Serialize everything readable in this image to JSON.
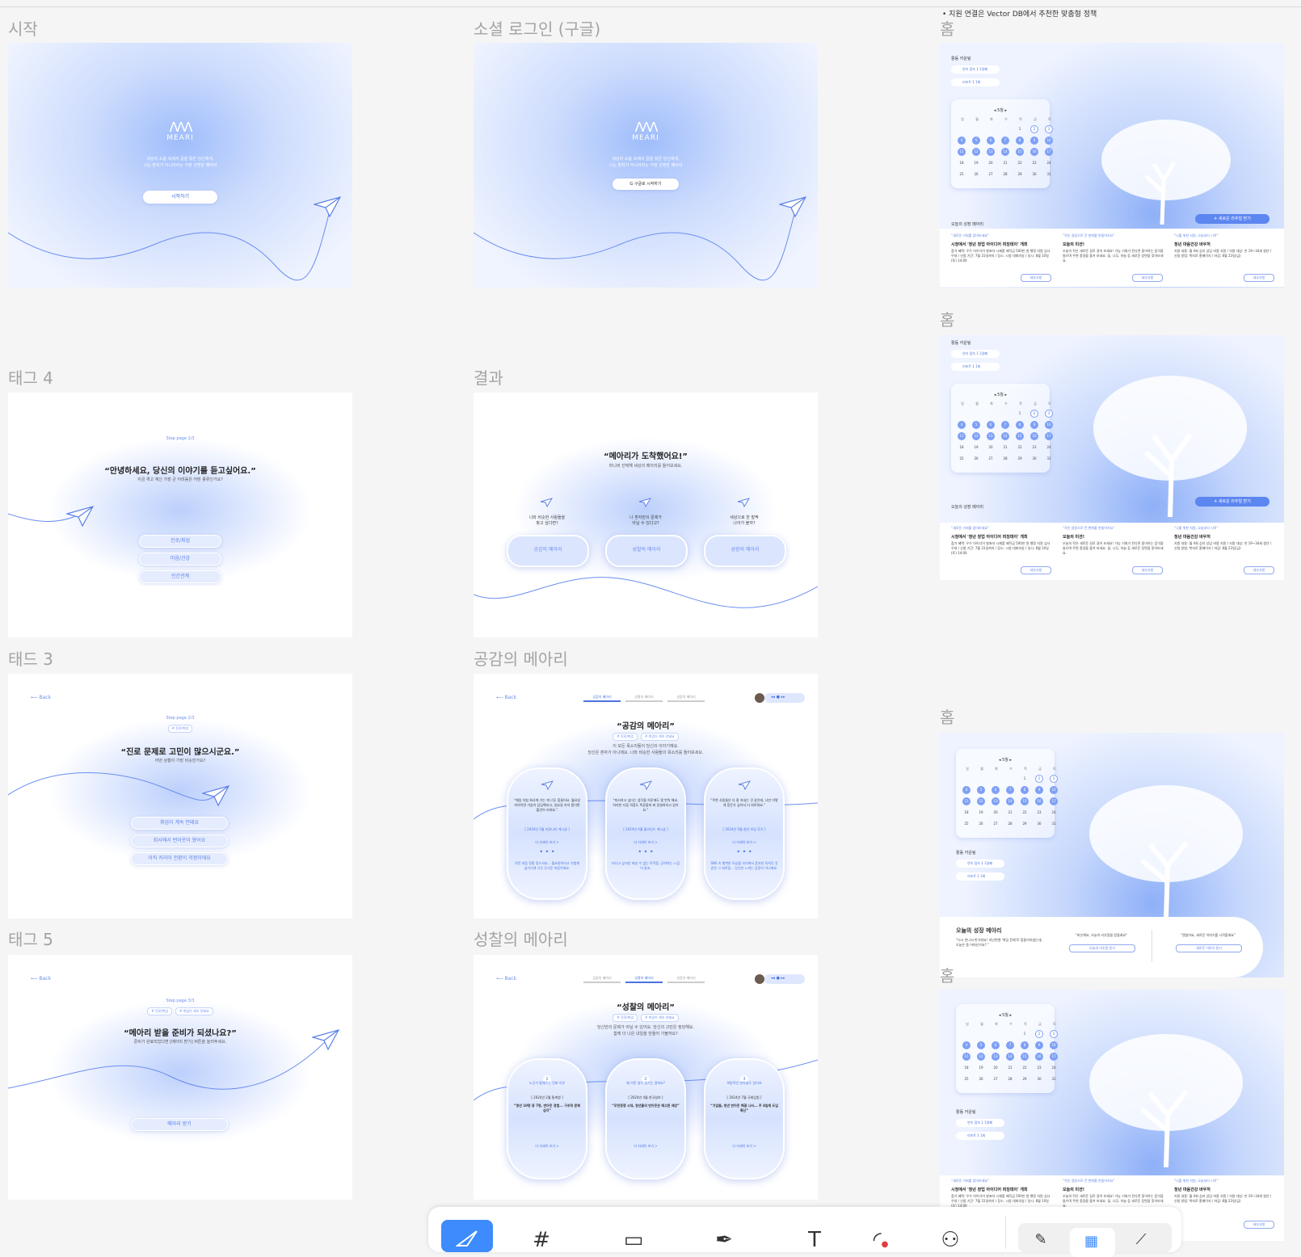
{
  "note": "• 지원 연결은 Vector DB에서 추천한 맞춤형 정책",
  "frames": {
    "start": {
      "label": "시작",
      "logo": "MEARI",
      "tagline1": "세상의 소음 속에서 길을 잃은 당신에게,",
      "tagline2": "나는 혼자가 아니라라는 가장 선명한 메아리",
      "button": "시작하기"
    },
    "social": {
      "label": "소셜 로그인 (구글)",
      "logo": "MEARI",
      "tagline1": "세상의 소음 속에서 길을 잃은 당신에게,",
      "tagline2": "나는 혼자가 아니라라는 가장 선명한 메아리",
      "button": "G  구글로 시작하기"
    },
    "tag4": {
      "label": "태그 4",
      "step": "Step page 1/3",
      "title": "“안녕하세요, 당신의 이야기를 듣고싶어요.”",
      "subtitle": "지금 겪고 계신 가장 큰 어려움은 어떤 종류인가요?",
      "options": [
        "진로/취업",
        "마음/건강",
        "인간관계"
      ]
    },
    "result": {
      "label": "결과",
      "title": "“메아리가 도착했어요!”",
      "subtitle": "마니버 선택해 세상의 메아리를 들어보세요.",
      "cols": [
        {
          "caption1": "나와 비슷한 사람들을",
          "caption2": "찾고 싶다면?",
          "button": "공감의 메아리"
        },
        {
          "caption1": "나 혼자만의 문제가",
          "caption2": "아닐 수 있다고?",
          "button": "성찰의 메아리"
        },
        {
          "caption1": "세상으로 한 발짝",
          "caption2": "나아가 볼까?",
          "button": "성장의 메아리"
        }
      ]
    },
    "tad3": {
      "label": "태드 3",
      "back": "Back",
      "step": "Step page 2/3",
      "chip": "# 진로/취업",
      "title": "“진로 문제로 고민이 많으시군요.”",
      "subtitle": "어떤 상황이 가장 비슷한가요?",
      "options": [
        "취업이 계속 안돼요",
        "회사에서 번아웃이 왔어요",
        "이직 커리어 전환이 걱정이에요"
      ]
    },
    "empathy": {
      "label": "공감의 메아리",
      "back": "Back",
      "tabs": [
        "공감의 메아리",
        "성찰의 메아리",
        "성장의 메아리"
      ],
      "title": "“공감의 메아리”",
      "chips": [
        "# 진로/취업",
        "# 취업이 계속 안돼요"
      ],
      "desc1": "이 모든 목소리들이 당신의 이야기예요.",
      "desc2": "당신은 혼자가 아니에요. 나와 비슷한 사람들의 목소리를 들어보세요.",
      "cards": [
        {
          "quote": "“매일 아침 회사에 가는 게 너무 힘들어요. 월요일 저녁이면 가슴이 답답해지고, 일요일 저녁 쯤이면 불안이 커져요.”",
          "src": "[ 2024년 3월 커뮤니티 게시글 ]",
          "more": "더 자세히 보기 >",
          "footer": "이런 마음 정말 힘드셔죠... 월요병이라고 가볍게 넘기기엔 너무 무거운 마음이에요."
        },
        {
          "quote": "“퇴사하고 싶다는 생각을 하루에도 몇 번씩 해요. 하지만 다음 직장도 똑같을까 봐 망설여지고 있어요.”",
          "src": "[ 2024년 4월 블라인드 게시글 ]",
          "more": "더 자세히 보기 >",
          "footer": "떠나고 싶지만 떠날 수 없는 막막함, 공허하는 느낌이 들죠."
        },
        {
          "quote": "“주변 사람들은 다 잘 지내는 것 같은데, 나만 이렇게 힘든가 싶어서 더 외로워요.”",
          "src": "[ 2024년 5월 청년 모임 후기 ]",
          "more": "더 자세히 보기 >",
          "footer": "SNS 속 행복한 모습을 사이에서 혼자만 뒤처진 것 같은 그 외로움... 당신만 느끼는 감정이 아니에요."
        }
      ]
    },
    "tag5": {
      "label": "태그 5",
      "back": "Back",
      "step": "Step page 3/3",
      "chips": [
        "# 진로/취업",
        "# 취업이 계속 안돼요"
      ],
      "title": "“메아리 받을 준비가 되셨나요?”",
      "subtitle": "준비가 완료되었다면 [메아리 받기] 버튼을 눌러주세요.",
      "button": "메아리 받기"
    },
    "reflection": {
      "label": "성찰의 메아리",
      "back": "Back",
      "tabs": [
        "공감의 메아리",
        "성찰의 메아리",
        "성장의 메아리"
      ],
      "title": "“성찰의 메아리”",
      "chips": [
        "# 진로/취업",
        "# 취업이 계속 안돼요"
      ],
      "desc1": "당신만의 문제가 아닐 수 있어요. 당신의 고민은 정당해요.",
      "desc2": "함께 더 나은 내일을 만들어 가볼까요?",
      "cards": [
        {
          "n": "1",
          "head": "누군가 말해주는 진짜 이유",
          "src": "[ 2024년 2월 통계청 ]",
          "quote": "“청년 10명 중 7명, 번아웃 경험... 구조적 문제 심각”",
          "more": "더 자세히 보기 >"
        },
        {
          "n": "2",
          "head": "왜 이런 일이 생기는 걸까요?",
          "src": "[ 2024년 4월 한국일보 ]",
          "quote": "“무한경쟁 시대, 청년들의 번아웃은 예고된 재앙”",
          "more": "더 자세히 보기 >"
        },
        {
          "n": "3",
          "head": "희망적인 변화들도 있어요",
          "src": "[ 2024년 7월 국회입법 ]",
          "quote": "“기업들, 청년 번아웃 해결 나서... 주 4일제 도입 확산”",
          "more": "더 자세히 보기 >"
        }
      ]
    }
  },
  "home": {
    "label": "홈",
    "activity_label": "활동 카운팅",
    "activities": [
      "연속 접속  1 1일째",
      "리포트  1 1회"
    ],
    "month": "5월",
    "weekdays": [
      "일",
      "월",
      "화",
      "수",
      "목",
      "금",
      "토"
    ],
    "days": [
      "",
      "",
      "",
      "",
      "1",
      "2",
      "3",
      "4",
      "5",
      "6",
      "7",
      "8",
      "9",
      "10",
      "11",
      "12",
      "13",
      "14",
      "15",
      "16",
      "17",
      "18",
      "19",
      "20",
      "21",
      "22",
      "23",
      "24",
      "25",
      "26",
      "27",
      "28",
      "29",
      "30",
      "31"
    ],
    "new_report": "새로운 리추얼 받기",
    "today": "오늘의 성장 메아리",
    "columns": [
      {
        "q": "“새로운 기회를 잡아보세요”",
        "t": "시청에서 '청년 창업 아이디어 피칭데이' 개최",
        "body": "참가 혜택: 우수 아이디어 발표자 시제품 제작금 500만 원 행정 지원 심사 우대 / 신청 기간: 7월 31일까지 / 장소: 시청 대회의실 / 일시: 8월 10일(토) 14:00",
        "btn": "세부사항"
      },
      {
        "q": "“작은 걸음으로 큰 변화를 만들어가요”",
        "t": "오늘의 미션!",
        "body": "오늘의 작은 새로운 길로 걸어 보세요! 가능 기회가 된다면 좋아하는 음악을 들으며 주변 풍경을 즐겨 보세요. 꽃, 나무, 하늘 등 새로운 장면을 찾아보세요.",
        "btn": "세부사항"
      },
      {
        "q": "“나를 위한 지원, 오늘부터 시작”",
        "t": "청년 마음건강 바우처",
        "body": "지원 내용: 월 4회 심리 상담 비용 지원 / 지원 대상: 만 19~34세 청년 / 신청 방법: 복지로 홈페이지 / 마감: 8월 23일(금)",
        "btn": "세부사항"
      }
    ],
    "home3": {
      "today": "오늘의 성장 메아리",
      "today_desc": "“다시 만나서 반가워요! 지난번엔 '취업 문제'로 힘들어하셨는데, 오늘은 좀 어떠신가요? ”",
      "mid_q": "“비슷해요, 오늘의 리추얼을 받을래요”",
      "mid_btn": "오늘의 리추얼 받기",
      "right_q": "“괜찮아요, 새로운 이야기를 시작할래요”",
      "right_btn": "새로운 이야기 받기"
    }
  },
  "toolbar": {
    "icons": [
      "move-tool",
      "frame-tool",
      "rectangle-tool",
      "pen-tool",
      "text-tool",
      "comment-tool",
      "assets-tool",
      "draw-mode",
      "design-mode",
      "dev-mode"
    ]
  },
  "colors": {
    "accent": "#4a72e0",
    "light": "#dbe5fe",
    "bg": "#f5f5f5"
  }
}
